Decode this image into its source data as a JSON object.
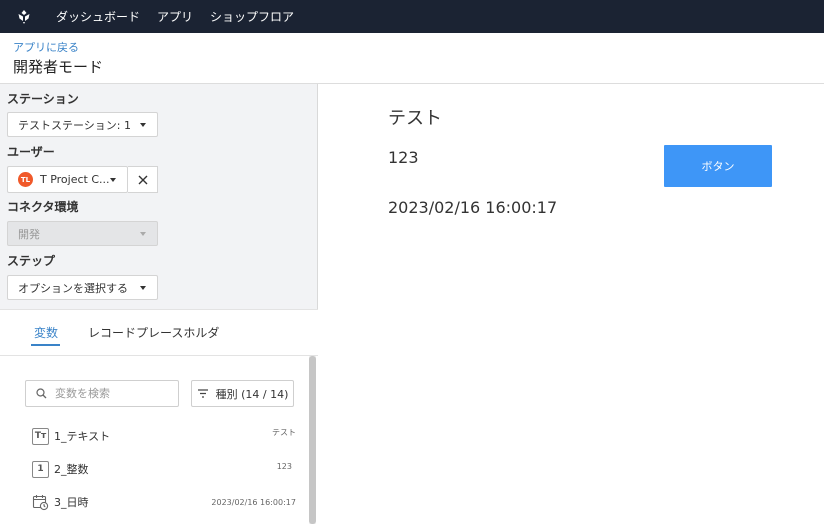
{
  "topbar": {
    "logo_icon": "tulip-logo-icon",
    "nav": [
      "ダッシュボード",
      "アプリ",
      "ショップフロア"
    ]
  },
  "header": {
    "back_link": "アプリに戻る",
    "title": "開発者モード"
  },
  "sidebar": {
    "station": {
      "label": "ステーション",
      "value": "テストステーション: 1"
    },
    "user": {
      "label": "ユーザー",
      "avatar_initials": "TL",
      "value": "T Project C...",
      "clear_icon": "close-icon"
    },
    "connector": {
      "label": "コネクタ環境",
      "value": "開発"
    },
    "step": {
      "label": "ステップ",
      "value": "オプションを選択する"
    },
    "tabs": [
      {
        "label": "変数",
        "active": true
      },
      {
        "label": "レコードプレースホルダ",
        "active": false
      }
    ],
    "search": {
      "placeholder": "変数を検索",
      "value": ""
    },
    "filter": {
      "label": "種別 (14 / 14)"
    },
    "variables": [
      {
        "icon": "Tт",
        "icon_name": "text-type-icon",
        "name": "1_テキスト",
        "value": "テスト"
      },
      {
        "icon": "1",
        "icon_name": "number-type-icon",
        "name": "2_整数",
        "value": "123"
      },
      {
        "icon": "",
        "icon_name": "datetime-type-icon",
        "name": "3_日時",
        "value": "2023/02/16 16:00:17"
      }
    ]
  },
  "canvas": {
    "text1": "テスト",
    "number": "123",
    "datetime": "2023/02/16 16:00:17",
    "button_label": "ボタン"
  },
  "colors": {
    "topbar_bg": "#1b2333",
    "accent": "#3a83c8",
    "button": "#3e96f7",
    "avatar": "#f0592a"
  }
}
